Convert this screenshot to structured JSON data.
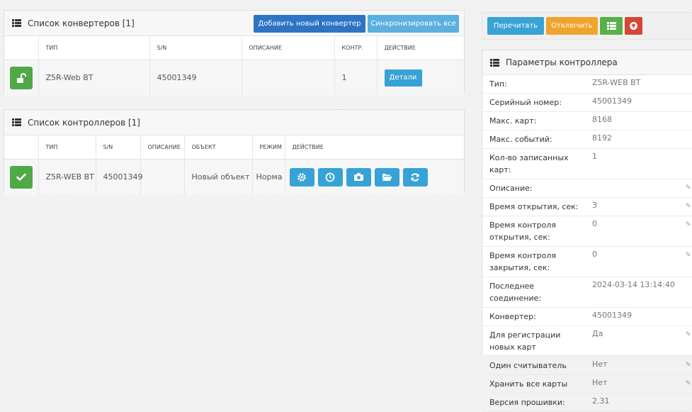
{
  "converters": {
    "title": "Список конвертеров [1]",
    "add_button": "Добавить новый конвертер",
    "sync_button": "Синхронизировать все",
    "columns": [
      "ТИП",
      "S/N",
      "ОПИСАНИЕ",
      "КОНТР.",
      "ДЕЙСТВИЕ"
    ],
    "rows": [
      {
        "status_icon": "unlock-icon",
        "type": "Z5R-Web BT",
        "sn": "45001349",
        "description": "",
        "controllers": "1",
        "action_label": "Детали"
      }
    ]
  },
  "controllers": {
    "title": "Список контроллеров [1]",
    "columns": [
      "ТИП",
      "S/N",
      "ОПИСАНИЕ",
      "ОБЪЕКТ",
      "РЕЖИМ",
      "ДЕЙСТВИЕ"
    ],
    "rows": [
      {
        "status_icon": "check-icon",
        "type": "Z5R-WEB BT",
        "sn": "45001349",
        "description": "",
        "object": "Новый объект",
        "mode": "Норма"
      }
    ],
    "action_icons": [
      "gear-icon",
      "clock-icon",
      "camera-icon",
      "folder-icon",
      "refresh-icon"
    ]
  },
  "toolbar": {
    "reread_label": "Перечитать",
    "disable_label": "Отключить",
    "list_icon": "list-icon",
    "power_icon": "power-icon"
  },
  "params": {
    "title": "Параметры контроллера",
    "rows": [
      {
        "key": "Тип:",
        "value": "Z5R-WEB BT",
        "editable": false
      },
      {
        "key": "Серийный номер:",
        "value": "45001349",
        "editable": false
      },
      {
        "key": "Макс. карт:",
        "value": "8168",
        "editable": false
      },
      {
        "key": "Макс. событий:",
        "value": "8192",
        "editable": false
      },
      {
        "key": "Кол-во записанных карт:",
        "value": "1",
        "editable": false
      },
      {
        "key": "Описание:",
        "value": "",
        "editable": true
      },
      {
        "key": "Время открытия, сек:",
        "value": "3",
        "editable": true
      },
      {
        "key": "Время контроля открытия, сек:",
        "value": "0",
        "editable": true
      },
      {
        "key": "Время контроля закрытия, сек:",
        "value": "0",
        "editable": true
      },
      {
        "key": "Последнее соединение:",
        "value": "2024-03-14 13:14:40",
        "editable": false
      },
      {
        "key": "Конвертер:",
        "value": "45001349",
        "editable": false
      },
      {
        "key": "Для регистрации новых карт",
        "value": "Да",
        "editable": true
      },
      {
        "key": "Один считыватель",
        "value": "Нет",
        "editable": true
      },
      {
        "key": "Хранить все карты",
        "value": "Нет",
        "editable": true
      },
      {
        "key": "Версия прошивки:",
        "value": "2.31",
        "editable": false
      }
    ]
  },
  "colors": {
    "primary": "#2e74c4",
    "info": "#37a2d6",
    "success": "#51a847",
    "warning": "#f0a42e",
    "danger": "#d64635"
  }
}
